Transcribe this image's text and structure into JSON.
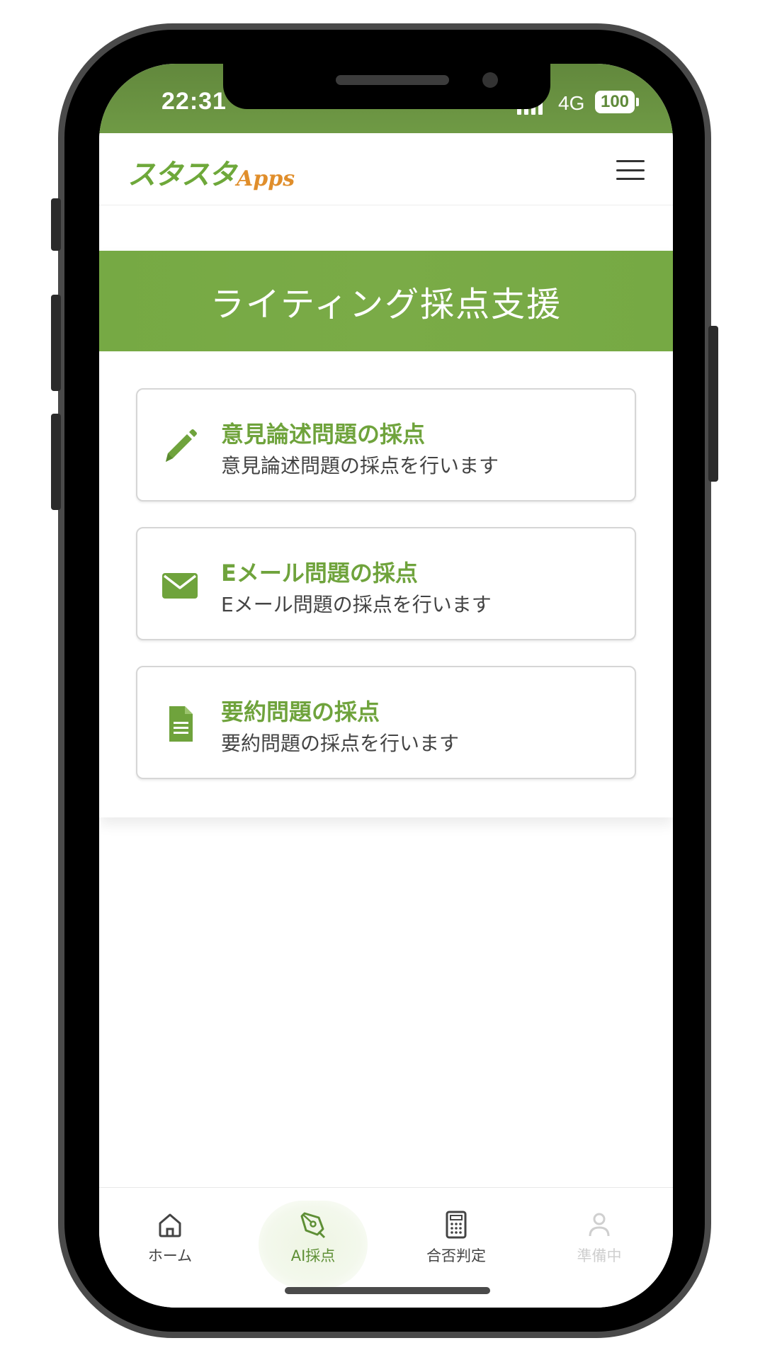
{
  "status_bar": {
    "time": "22:31",
    "network": "4G",
    "battery": "100"
  },
  "header": {
    "logo_main": "スタスタ",
    "logo_sub": "Apps"
  },
  "page": {
    "title": "ライティング採点支援"
  },
  "options": [
    {
      "title": "意見論述問題の採点",
      "description": "意見論述問題の採点を行います",
      "icon": "pencil-icon"
    },
    {
      "title": "Eメール問題の採点",
      "description": "Eメール問題の採点を行います",
      "icon": "envelope-icon"
    },
    {
      "title": "要約問題の採点",
      "description": "要約問題の採点を行います",
      "icon": "document-icon"
    }
  ],
  "bottom_nav": [
    {
      "label": "ホーム",
      "icon": "home-icon"
    },
    {
      "label": "AI採点",
      "icon": "pen-nib-icon",
      "active": true
    },
    {
      "label": "合否判定",
      "icon": "calculator-icon"
    },
    {
      "label": "準備中",
      "icon": "user-icon",
      "disabled": true
    }
  ],
  "colors": {
    "brand_green": "#76a944",
    "logo_orange": "#e08e2b",
    "status_bar_green": "#66903f"
  }
}
